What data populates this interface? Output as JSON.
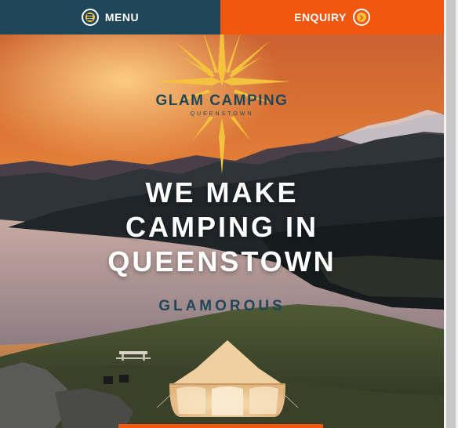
{
  "nav": {
    "menu_label": "MENU",
    "enquiry_label": "ENQUIRY",
    "menu_color": "#1f4759",
    "enquiry_color": "#f2570f",
    "accent": "#f5c23e"
  },
  "logo": {
    "title": "GLAM CAMPING",
    "subtitle": "QUEENSTOWN"
  },
  "hero": {
    "headline_line1": "WE MAKE",
    "headline_line2": "CAMPING IN",
    "headline_line3": "QUEENSTOWN",
    "tagline": "GLAMOROUS"
  },
  "icons": {
    "menu": "hamburger-circle-icon",
    "enquiry": "chevron-right-circle-icon",
    "logo_mark": "sunburst-star-icon"
  }
}
